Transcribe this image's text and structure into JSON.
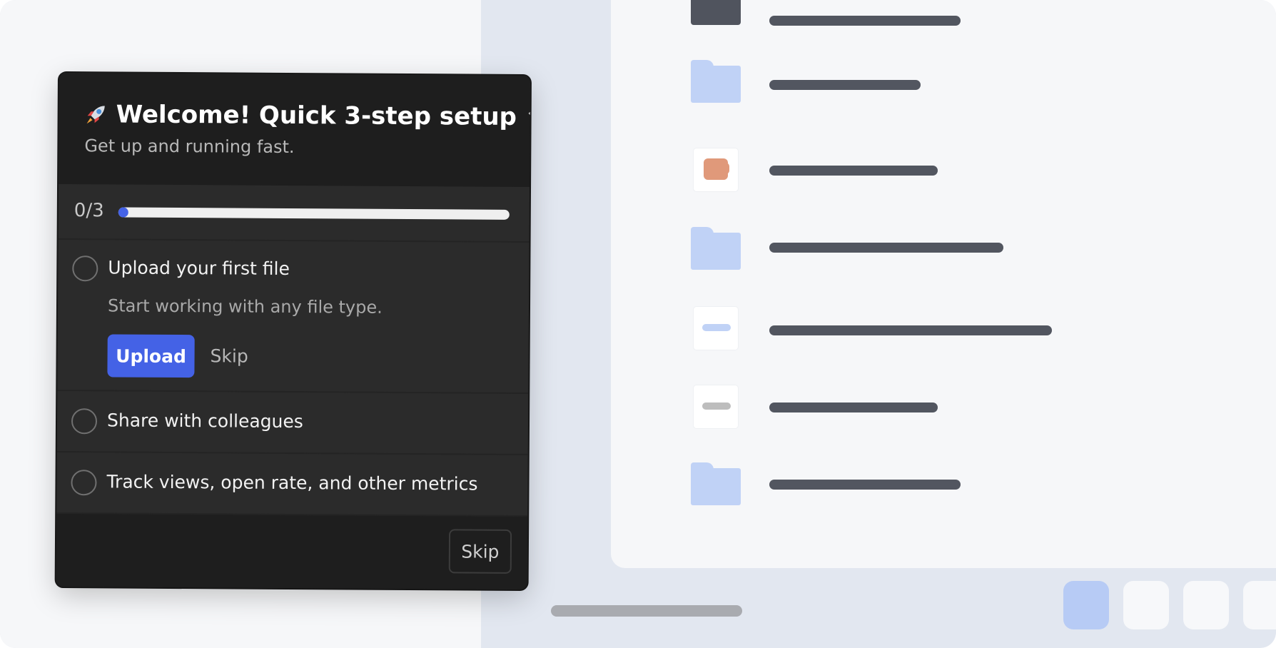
{
  "onboarding": {
    "title": "Welcome! Quick 3-step setup",
    "subtitle": "Get up and running fast.",
    "progress": {
      "label": "0/3",
      "completed": 0,
      "total": 3
    },
    "steps": [
      {
        "title": "Upload your first file",
        "description": "Start working with any file type.",
        "primary_action": "Upload",
        "secondary_action": "Skip",
        "expanded": true
      },
      {
        "title": "Share with colleagues",
        "expanded": false
      },
      {
        "title": "Track views, open rate, and other metrics",
        "expanded": false
      }
    ],
    "footer": {
      "skip_label": "Skip"
    }
  },
  "file_list": {
    "rows": [
      {
        "icon": "dark-file-icon"
      },
      {
        "icon": "folder-icon"
      },
      {
        "icon": "orange-document-icon"
      },
      {
        "icon": "folder-icon"
      },
      {
        "icon": "blue-line-file-icon"
      },
      {
        "icon": "gray-line-file-icon"
      },
      {
        "icon": "folder-icon"
      }
    ]
  },
  "colors": {
    "accent": "#4462e6",
    "popup_bg": "#2b2b2b",
    "folder": "#c0d2f6",
    "orange_file": "#e0997a"
  }
}
